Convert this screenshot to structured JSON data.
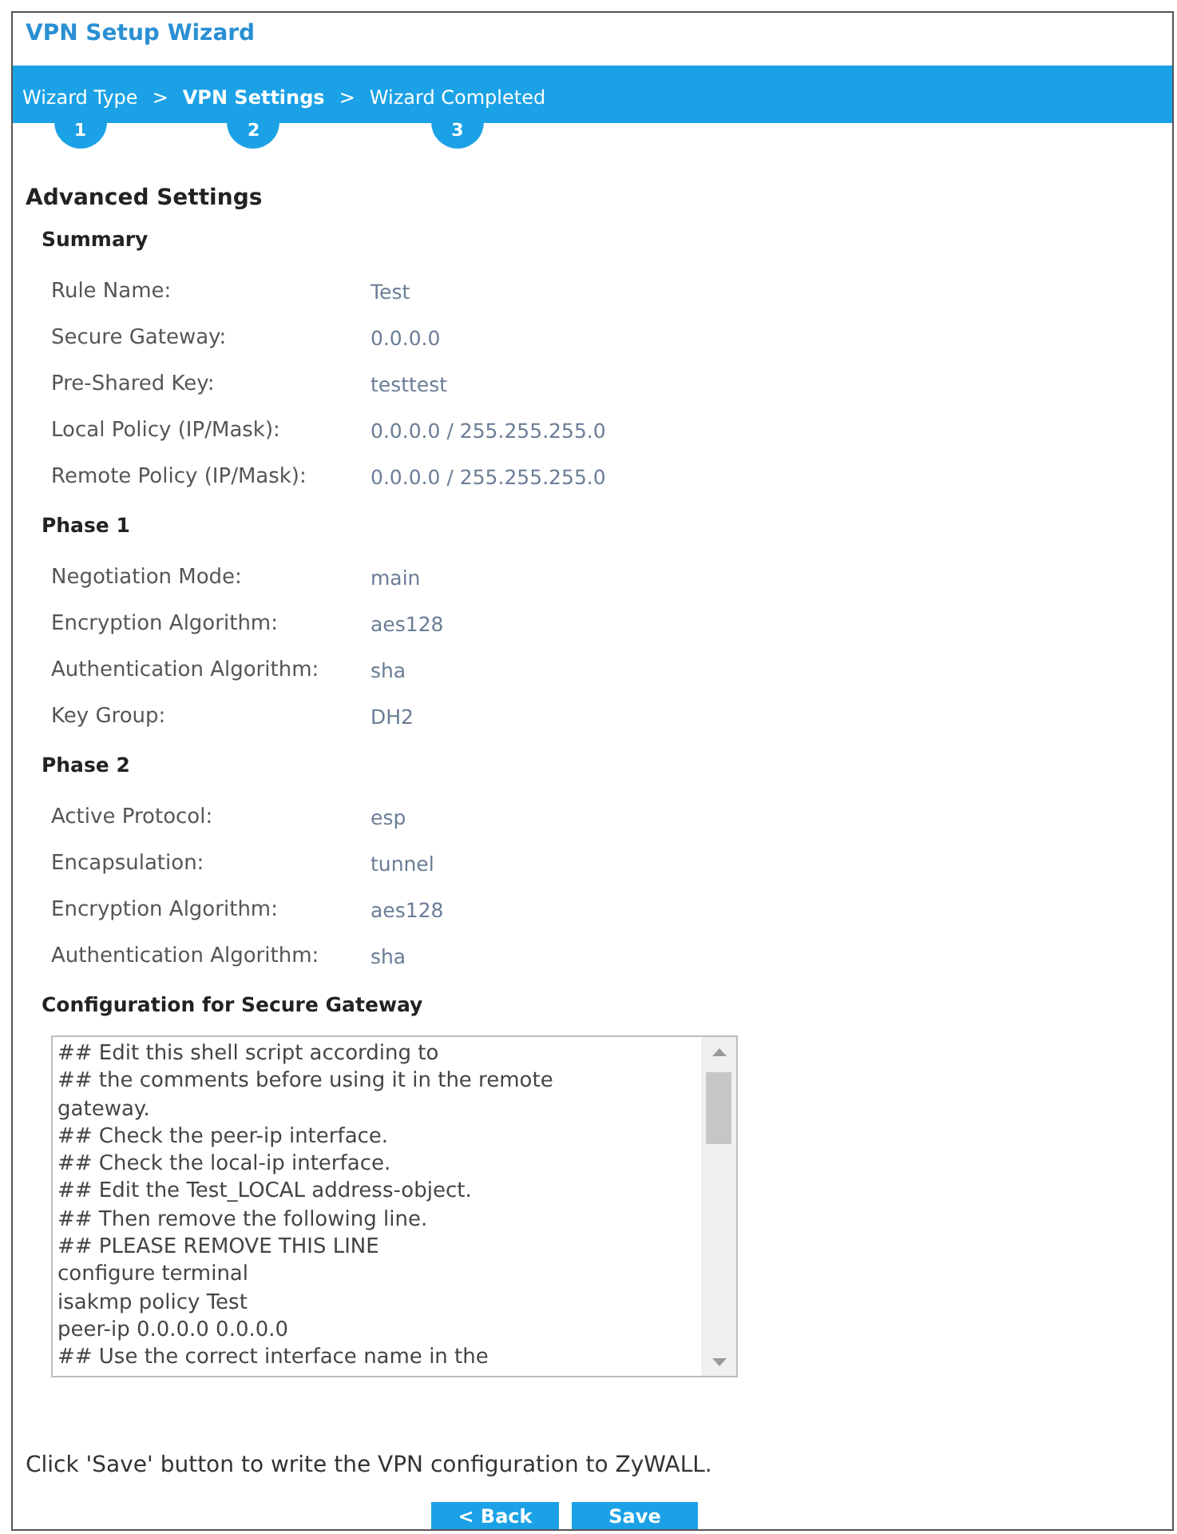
{
  "window": {
    "title": "VPN Setup Wizard"
  },
  "steps": [
    {
      "label": "Wizard Type",
      "number": "1",
      "selected": false
    },
    {
      "separator": ">",
      "label": "VPN Settings",
      "number": "2",
      "selected": true
    },
    {
      "separator": ">",
      "label": "Wizard Completed",
      "number": "3",
      "selected": false
    }
  ],
  "page_heading": "Advanced Settings",
  "sections": [
    {
      "title": "Summary",
      "rows": [
        {
          "label": "Rule Name:",
          "value": "Test"
        },
        {
          "label": "Secure Gateway:",
          "value": "0.0.0.0"
        },
        {
          "label": "Pre-Shared Key:",
          "value": "testtest"
        },
        {
          "label": "Local Policy (IP/Mask):",
          "value": "0.0.0.0 / 255.255.255.0"
        },
        {
          "label": "Remote Policy (IP/Mask):",
          "value": "0.0.0.0 / 255.255.255.0"
        }
      ]
    },
    {
      "title": "Phase 1",
      "rows": [
        {
          "label": "Negotiation Mode:",
          "value": "main"
        },
        {
          "label": "Encryption Algorithm:",
          "value": "aes128"
        },
        {
          "label": "Authentication Algorithm:",
          "value": "sha"
        },
        {
          "label": "Key Group:",
          "value": "DH2"
        }
      ]
    },
    {
      "title": "Phase 2",
      "rows": [
        {
          "label": "Active Protocol:",
          "value": "esp"
        },
        {
          "label": "Encapsulation:",
          "value": "tunnel"
        },
        {
          "label": "Encryption Algorithm:",
          "value": "aes128"
        },
        {
          "label": "Authentication Algorithm:",
          "value": "sha"
        }
      ]
    }
  ],
  "config": {
    "title": "Configuration for Secure Gateway",
    "lines": [
      "## Edit this shell script according to",
      "## the comments before using it in the remote",
      "gateway.",
      "## Check the peer-ip interface.",
      "## Check the local-ip interface.",
      "## Edit the Test_LOCAL address-object.",
      "## Then remove the following line.",
      "## PLEASE REMOVE THIS LINE",
      "configure terminal",
      "isakmp policy Test",
      "peer-ip 0.0.0.0 0.0.0.0",
      "## Use the correct interface name in the"
    ]
  },
  "note": "Click 'Save' button to write the VPN configuration to ZyWALL.",
  "buttons": [
    "< Back",
    "Save"
  ]
}
